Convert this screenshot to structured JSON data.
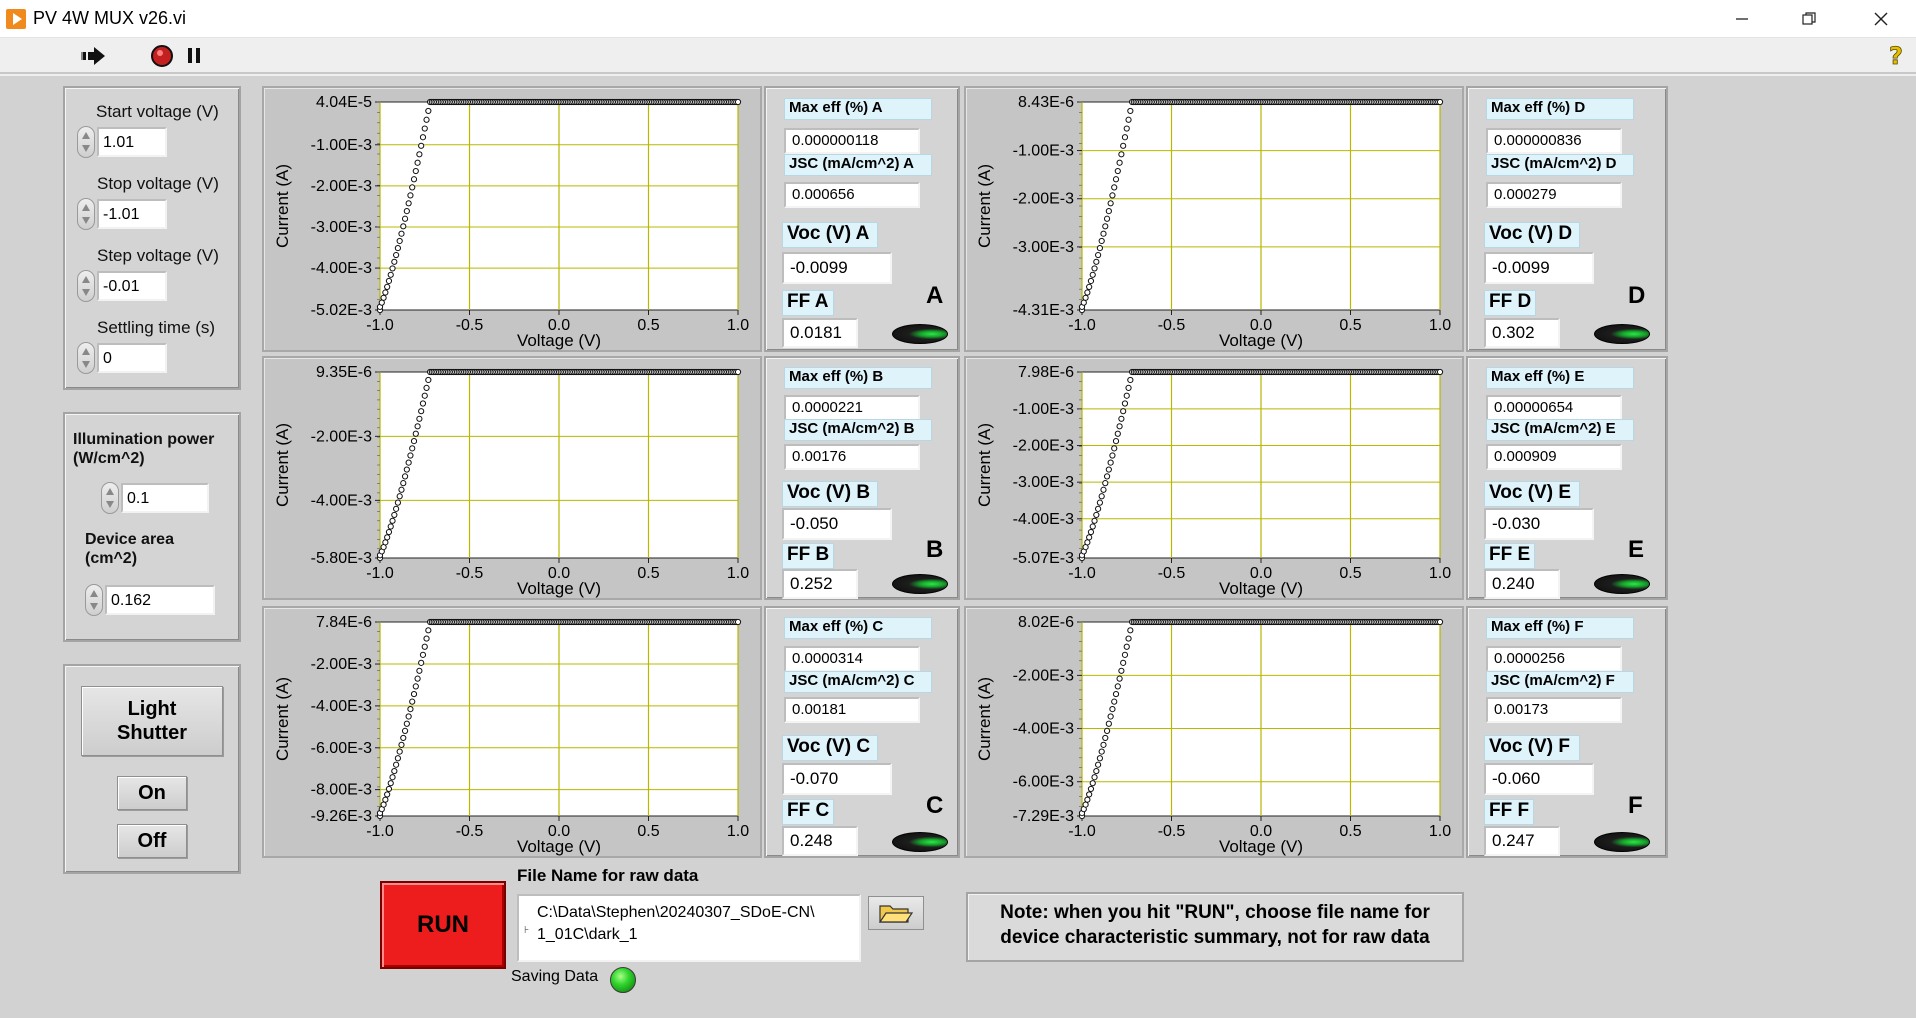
{
  "window": {
    "title": "PV 4W MUX v26.vi"
  },
  "params": {
    "start_label": "Start voltage (V)",
    "start_value": "1.01",
    "stop_label": "Stop voltage (V)",
    "stop_value": "-1.01",
    "step_label": "Step voltage (V)",
    "step_value": "-0.01",
    "settle_label": "Settling time (s)",
    "settle_value": "0"
  },
  "illum": {
    "power_label": "Illumination power\n(W/cm^2)",
    "power_value": "0.1",
    "area_label": "Device area\n(cm^2)",
    "area_value": "0.162"
  },
  "shutter": {
    "title": "Light\nShutter",
    "on": "On",
    "off": "Off"
  },
  "panels": [
    {
      "letter": "A",
      "maxeff_label": "Max eff (%) A",
      "maxeff": "0.000000118",
      "jsc_label": "JSC (mA/cm^2) A",
      "jsc": "0.000656",
      "voc_label": "Voc (V) A",
      "voc": "-0.0099",
      "ff_label": "FF A",
      "ff": "0.0181"
    },
    {
      "letter": "B",
      "maxeff_label": "Max eff (%) B",
      "maxeff": "0.0000221",
      "jsc_label": "JSC (mA/cm^2) B",
      "jsc": "0.00176",
      "voc_label": "Voc (V) B",
      "voc": "-0.050",
      "ff_label": "FF B",
      "ff": "0.252"
    },
    {
      "letter": "C",
      "maxeff_label": "Max eff (%) C",
      "maxeff": "0.0000314",
      "jsc_label": "JSC (mA/cm^2) C",
      "jsc": "0.00181",
      "voc_label": "Voc (V) C",
      "voc": "-0.070",
      "ff_label": "FF C",
      "ff": "0.248"
    },
    {
      "letter": "D",
      "maxeff_label": "Max eff (%) D",
      "maxeff": "0.000000836",
      "jsc_label": "JSC (mA/cm^2) D",
      "jsc": "0.000279",
      "voc_label": "Voc (V) D",
      "voc": "-0.0099",
      "ff_label": "FF D",
      "ff": "0.302"
    },
    {
      "letter": "E",
      "maxeff_label": "Max eff (%) E",
      "maxeff": "0.00000654",
      "jsc_label": "JSC (mA/cm^2) E",
      "jsc": "0.000909",
      "voc_label": "Voc (V) E",
      "voc": "-0.030",
      "ff_label": "FF E",
      "ff": "0.240"
    },
    {
      "letter": "F",
      "maxeff_label": "Max eff (%) F",
      "maxeff": "0.0000256",
      "jsc_label": "JSC (mA/cm^2) F",
      "jsc": "0.00173",
      "voc_label": "Voc (V) F",
      "voc": "-0.060",
      "ff_label": "FF F",
      "ff": "0.247"
    }
  ],
  "run": {
    "label": "RUN",
    "file_label": "File Name for raw data",
    "path": "C:\\Data\\Stephen\\20240307_SDoE-CN\\\n1_01C\\dark_1",
    "saving_label": "Saving Data"
  },
  "note": "Note: when you hit \"RUN\", choose file name for\ndevice characteristic summary, not for raw data",
  "colors": {
    "plot_bg": "#ffffff",
    "grid": "#b8b800",
    "run": "#ee1d1d",
    "led_on": "#33d62f"
  },
  "chart_data": [
    {
      "type": "scatter",
      "id": "A",
      "xlabel": "Voltage (V)",
      "ylabel": "Current (A)",
      "xlim": [
        -1.0,
        1.0
      ],
      "ylim": [
        -0.00502,
        4.04e-05
      ],
      "x_ticks": [
        "-1.0",
        "-0.5",
        "0.0",
        "0.5",
        "1.0"
      ],
      "y_ticks": [
        "4.04E-5",
        "-1.00E-3",
        "-2.00E-3",
        "-3.00E-3",
        "-4.00E-3",
        "-5.02E-3"
      ],
      "y_tick_values": [
        4.04e-05,
        -0.001,
        -0.002,
        -0.003,
        -0.004,
        -0.00502
      ],
      "grid": true,
      "curve": {
        "start_v": -1.01,
        "min_current": -0.00502,
        "knee_v": -0.72,
        "plateau_current": 4.04e-05
      }
    },
    {
      "type": "scatter",
      "id": "B",
      "xlabel": "Voltage (V)",
      "ylabel": "Current (A)",
      "xlim": [
        -1.0,
        1.0
      ],
      "ylim": [
        -0.0058,
        9.35e-06
      ],
      "x_ticks": [
        "-1.0",
        "-0.5",
        "0.0",
        "0.5",
        "1.0"
      ],
      "y_ticks": [
        "9.35E-6",
        "-2.00E-3",
        "-4.00E-3",
        "-5.80E-3"
      ],
      "y_tick_values": [
        9.35e-06,
        -0.002,
        -0.004,
        -0.0058
      ],
      "grid": true,
      "curve": {
        "start_v": -1.01,
        "min_current": -0.0058,
        "knee_v": -0.72,
        "plateau_current": 9.35e-06
      }
    },
    {
      "type": "scatter",
      "id": "C",
      "xlabel": "Voltage (V)",
      "ylabel": "Current (A)",
      "xlim": [
        -1.0,
        1.0
      ],
      "ylim": [
        -0.00926,
        7.84e-06
      ],
      "x_ticks": [
        "-1.0",
        "-0.5",
        "0.0",
        "0.5",
        "1.0"
      ],
      "y_ticks": [
        "7.84E-6",
        "-2.00E-3",
        "-4.00E-3",
        "-6.00E-3",
        "-8.00E-3",
        "-9.26E-3"
      ],
      "y_tick_values": [
        7.84e-06,
        -0.002,
        -0.004,
        -0.006,
        -0.008,
        -0.00926
      ],
      "grid": true,
      "curve": {
        "start_v": -1.01,
        "min_current": -0.00926,
        "knee_v": -0.72,
        "plateau_current": 7.84e-06
      }
    },
    {
      "type": "scatter",
      "id": "D",
      "xlabel": "Voltage (V)",
      "ylabel": "Current (A)",
      "xlim": [
        -1.0,
        1.0
      ],
      "ylim": [
        -0.00431,
        8.43e-06
      ],
      "x_ticks": [
        "-1.0",
        "-0.5",
        "0.0",
        "0.5",
        "1.0"
      ],
      "y_ticks": [
        "8.43E-6",
        "-1.00E-3",
        "-2.00E-3",
        "-3.00E-3",
        "-4.31E-3"
      ],
      "y_tick_values": [
        8.43e-06,
        -0.001,
        -0.002,
        -0.003,
        -0.00431
      ],
      "grid": true,
      "curve": {
        "start_v": -1.01,
        "min_current": -0.00431,
        "knee_v": -0.72,
        "plateau_current": 8.43e-06
      }
    },
    {
      "type": "scatter",
      "id": "E",
      "xlabel": "Voltage (V)",
      "ylabel": "Current (A)",
      "xlim": [
        -1.0,
        1.0
      ],
      "ylim": [
        -0.00507,
        7.98e-06
      ],
      "x_ticks": [
        "-1.0",
        "-0.5",
        "0.0",
        "0.5",
        "1.0"
      ],
      "y_ticks": [
        "7.98E-6",
        "-1.00E-3",
        "-2.00E-3",
        "-3.00E-3",
        "-4.00E-3",
        "-5.07E-3"
      ],
      "y_tick_values": [
        7.98e-06,
        -0.001,
        -0.002,
        -0.003,
        -0.004,
        -0.00507
      ],
      "grid": true,
      "curve": {
        "start_v": -1.01,
        "min_current": -0.00507,
        "knee_v": -0.72,
        "plateau_current": 7.98e-06
      }
    },
    {
      "type": "scatter",
      "id": "F",
      "xlabel": "Voltage (V)",
      "ylabel": "Current (A)",
      "xlim": [
        -1.0,
        1.0
      ],
      "ylim": [
        -0.00729,
        8.02e-06
      ],
      "x_ticks": [
        "-1.0",
        "-0.5",
        "0.0",
        "0.5",
        "1.0"
      ],
      "y_ticks": [
        "8.02E-6",
        "-2.00E-3",
        "-4.00E-3",
        "-6.00E-3",
        "-7.29E-3"
      ],
      "y_tick_values": [
        8.02e-06,
        -0.002,
        -0.004,
        -0.006,
        -0.00729
      ],
      "grid": true,
      "curve": {
        "start_v": -1.01,
        "min_current": -0.00729,
        "knee_v": -0.72,
        "plateau_current": 8.02e-06
      }
    }
  ]
}
